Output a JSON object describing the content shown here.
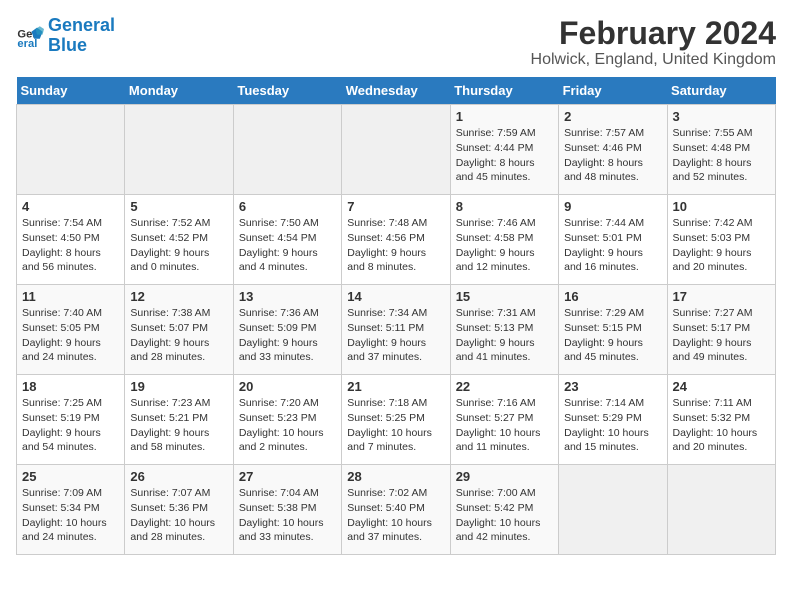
{
  "logo": {
    "line1": "General",
    "line2": "Blue"
  },
  "title": "February 2024",
  "subtitle": "Holwick, England, United Kingdom",
  "days_of_week": [
    "Sunday",
    "Monday",
    "Tuesday",
    "Wednesday",
    "Thursday",
    "Friday",
    "Saturday"
  ],
  "weeks": [
    [
      {
        "day": "",
        "info": ""
      },
      {
        "day": "",
        "info": ""
      },
      {
        "day": "",
        "info": ""
      },
      {
        "day": "",
        "info": ""
      },
      {
        "day": "1",
        "info": "Sunrise: 7:59 AM\nSunset: 4:44 PM\nDaylight: 8 hours and 45 minutes."
      },
      {
        "day": "2",
        "info": "Sunrise: 7:57 AM\nSunset: 4:46 PM\nDaylight: 8 hours and 48 minutes."
      },
      {
        "day": "3",
        "info": "Sunrise: 7:55 AM\nSunset: 4:48 PM\nDaylight: 8 hours and 52 minutes."
      }
    ],
    [
      {
        "day": "4",
        "info": "Sunrise: 7:54 AM\nSunset: 4:50 PM\nDaylight: 8 hours and 56 minutes."
      },
      {
        "day": "5",
        "info": "Sunrise: 7:52 AM\nSunset: 4:52 PM\nDaylight: 9 hours and 0 minutes."
      },
      {
        "day": "6",
        "info": "Sunrise: 7:50 AM\nSunset: 4:54 PM\nDaylight: 9 hours and 4 minutes."
      },
      {
        "day": "7",
        "info": "Sunrise: 7:48 AM\nSunset: 4:56 PM\nDaylight: 9 hours and 8 minutes."
      },
      {
        "day": "8",
        "info": "Sunrise: 7:46 AM\nSunset: 4:58 PM\nDaylight: 9 hours and 12 minutes."
      },
      {
        "day": "9",
        "info": "Sunrise: 7:44 AM\nSunset: 5:01 PM\nDaylight: 9 hours and 16 minutes."
      },
      {
        "day": "10",
        "info": "Sunrise: 7:42 AM\nSunset: 5:03 PM\nDaylight: 9 hours and 20 minutes."
      }
    ],
    [
      {
        "day": "11",
        "info": "Sunrise: 7:40 AM\nSunset: 5:05 PM\nDaylight: 9 hours and 24 minutes."
      },
      {
        "day": "12",
        "info": "Sunrise: 7:38 AM\nSunset: 5:07 PM\nDaylight: 9 hours and 28 minutes."
      },
      {
        "day": "13",
        "info": "Sunrise: 7:36 AM\nSunset: 5:09 PM\nDaylight: 9 hours and 33 minutes."
      },
      {
        "day": "14",
        "info": "Sunrise: 7:34 AM\nSunset: 5:11 PM\nDaylight: 9 hours and 37 minutes."
      },
      {
        "day": "15",
        "info": "Sunrise: 7:31 AM\nSunset: 5:13 PM\nDaylight: 9 hours and 41 minutes."
      },
      {
        "day": "16",
        "info": "Sunrise: 7:29 AM\nSunset: 5:15 PM\nDaylight: 9 hours and 45 minutes."
      },
      {
        "day": "17",
        "info": "Sunrise: 7:27 AM\nSunset: 5:17 PM\nDaylight: 9 hours and 49 minutes."
      }
    ],
    [
      {
        "day": "18",
        "info": "Sunrise: 7:25 AM\nSunset: 5:19 PM\nDaylight: 9 hours and 54 minutes."
      },
      {
        "day": "19",
        "info": "Sunrise: 7:23 AM\nSunset: 5:21 PM\nDaylight: 9 hours and 58 minutes."
      },
      {
        "day": "20",
        "info": "Sunrise: 7:20 AM\nSunset: 5:23 PM\nDaylight: 10 hours and 2 minutes."
      },
      {
        "day": "21",
        "info": "Sunrise: 7:18 AM\nSunset: 5:25 PM\nDaylight: 10 hours and 7 minutes."
      },
      {
        "day": "22",
        "info": "Sunrise: 7:16 AM\nSunset: 5:27 PM\nDaylight: 10 hours and 11 minutes."
      },
      {
        "day": "23",
        "info": "Sunrise: 7:14 AM\nSunset: 5:29 PM\nDaylight: 10 hours and 15 minutes."
      },
      {
        "day": "24",
        "info": "Sunrise: 7:11 AM\nSunset: 5:32 PM\nDaylight: 10 hours and 20 minutes."
      }
    ],
    [
      {
        "day": "25",
        "info": "Sunrise: 7:09 AM\nSunset: 5:34 PM\nDaylight: 10 hours and 24 minutes."
      },
      {
        "day": "26",
        "info": "Sunrise: 7:07 AM\nSunset: 5:36 PM\nDaylight: 10 hours and 28 minutes."
      },
      {
        "day": "27",
        "info": "Sunrise: 7:04 AM\nSunset: 5:38 PM\nDaylight: 10 hours and 33 minutes."
      },
      {
        "day": "28",
        "info": "Sunrise: 7:02 AM\nSunset: 5:40 PM\nDaylight: 10 hours and 37 minutes."
      },
      {
        "day": "29",
        "info": "Sunrise: 7:00 AM\nSunset: 5:42 PM\nDaylight: 10 hours and 42 minutes."
      },
      {
        "day": "",
        "info": ""
      },
      {
        "day": "",
        "info": ""
      }
    ]
  ]
}
